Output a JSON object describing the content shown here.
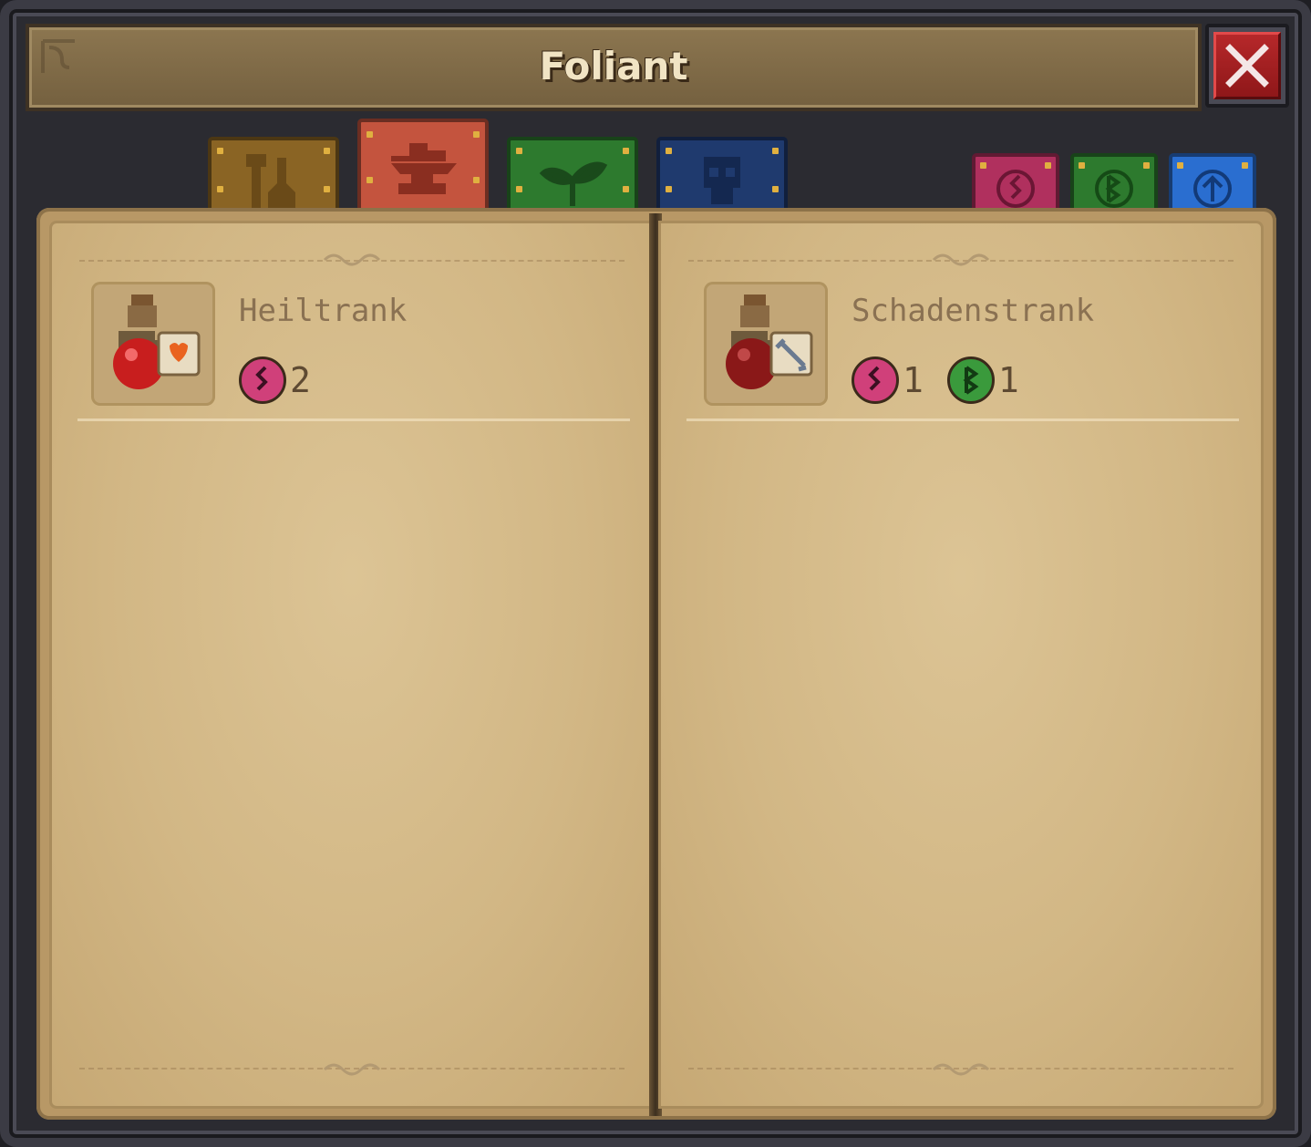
{
  "window": {
    "title": "Foliant",
    "close_icon": "close-icon"
  },
  "category_tabs": [
    {
      "icon": "tools-icon",
      "color": "#8a6424"
    },
    {
      "icon": "anvil-icon",
      "color": "#c4543e",
      "active": true
    },
    {
      "icon": "herb-icon",
      "color": "#2d7a2e"
    },
    {
      "icon": "skull-icon",
      "color": "#1f3a6e"
    }
  ],
  "rune_tabs": [
    {
      "icon": "rune-zigzag-icon",
      "color": "#b0305e"
    },
    {
      "icon": "rune-b-icon",
      "color": "#2d7a2e"
    },
    {
      "icon": "rune-arrow-icon",
      "color": "#2a6ed0"
    }
  ],
  "recipes": [
    {
      "name": "Heiltrank",
      "icon": "healing-potion-icon",
      "costs": [
        {
          "rune": "rune-zigzag-icon",
          "color": "#d0407a",
          "amount": "2"
        }
      ]
    },
    {
      "name": "Schadenstrank",
      "icon": "damage-potion-icon",
      "costs": [
        {
          "rune": "rune-zigzag-icon",
          "color": "#d0407a",
          "amount": "1"
        },
        {
          "rune": "rune-b-icon",
          "color": "#3a9a3c",
          "amount": "1"
        }
      ]
    }
  ]
}
